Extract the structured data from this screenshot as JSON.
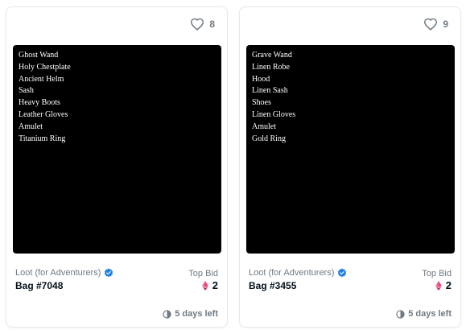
{
  "colors": {
    "accent_blue": "#2081e2",
    "eth_pink": "#e2467b",
    "muted_text": "#707a83",
    "dark_text": "#04111d",
    "art_background": "#000000"
  },
  "cards": [
    {
      "favorite_count": "8",
      "art_lines": [
        "Ghost Wand",
        "Holy Chestplate",
        "Ancient Helm",
        "Sash",
        "Heavy Boots",
        "Leather Gloves",
        "Amulet",
        "Titanium Ring"
      ],
      "collection": "Loot (for Adventurers)",
      "verified_icon": "verified-badge-icon",
      "name": "Bag #7048",
      "bid_label": "Top Bid",
      "bid_value": "2",
      "currency_icon": "eth-icon",
      "time_left": "5 days left",
      "time_icon": "clock-icon"
    },
    {
      "favorite_count": "9",
      "art_lines": [
        "Grave Wand",
        "Linen Robe",
        "Hood",
        "Linen Sash",
        "Shoes",
        "Linen Gloves",
        "Amulet",
        "Gold Ring"
      ],
      "collection": "Loot (for Adventurers)",
      "verified_icon": "verified-badge-icon",
      "name": "Bag #3455",
      "bid_label": "Top Bid",
      "bid_value": "2",
      "currency_icon": "eth-icon",
      "time_left": "5 days left",
      "time_icon": "clock-icon"
    }
  ]
}
